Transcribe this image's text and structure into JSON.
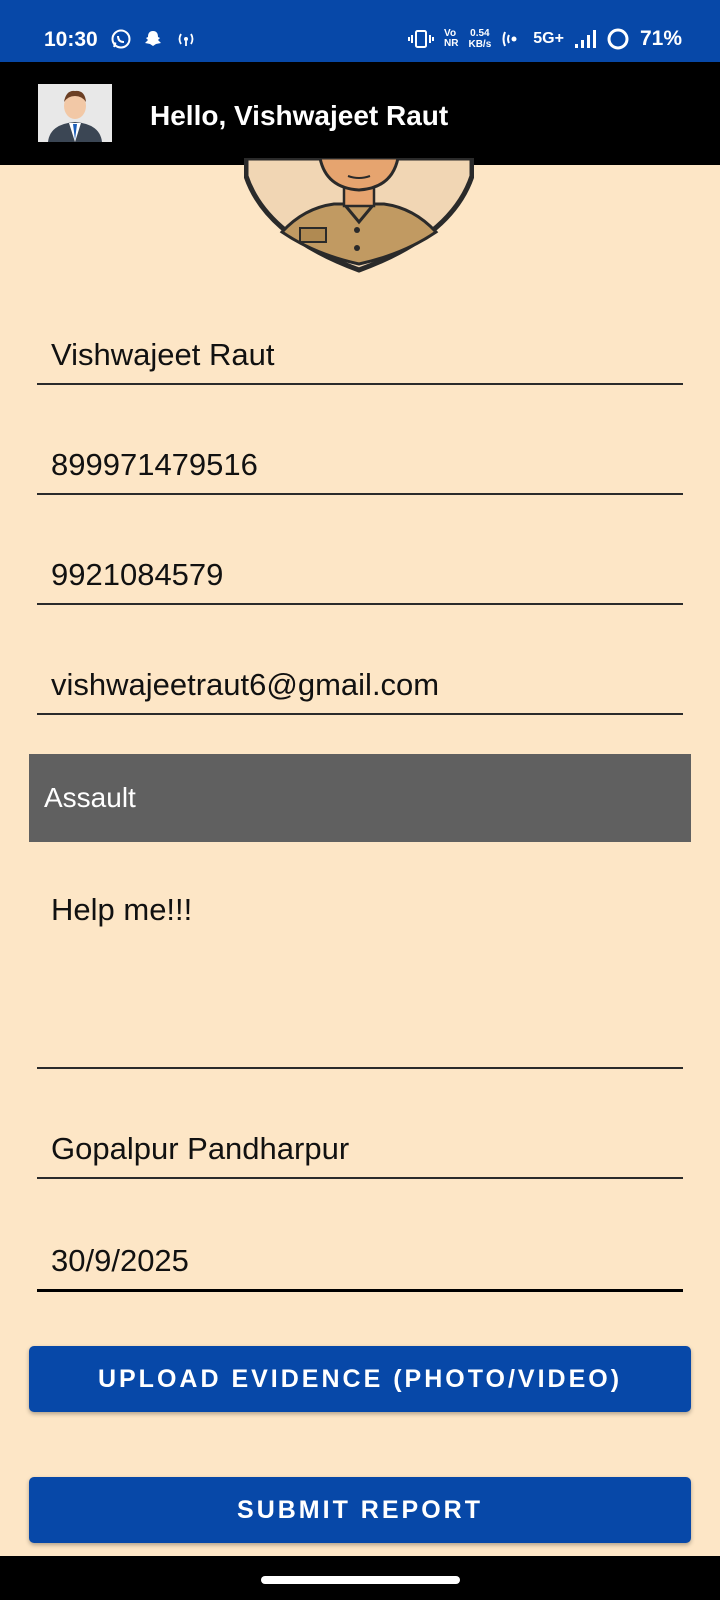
{
  "status": {
    "time": "10:30",
    "volte_top": "Vo",
    "volte_bottom": "NR",
    "speed_value": "0.54",
    "speed_unit": "KB/s",
    "network": "5G+",
    "battery": "71%"
  },
  "header": {
    "greeting": "Hello, Vishwajeet Raut"
  },
  "form": {
    "name": "Vishwajeet Raut",
    "aadhaar": "899971479516",
    "phone": "9921084579",
    "email": "vishwajeetraut6@gmail.com",
    "incident_type": "Assault",
    "description": "Help me!!!",
    "location": "Gopalpur Pandharpur",
    "date": "30/9/2025"
  },
  "buttons": {
    "upload": "UPLOAD EVIDENCE (PHOTO/VIDEO)",
    "submit": "SUBMIT REPORT"
  },
  "colors": {
    "primary": "#0748a8",
    "background": "#fde6c6",
    "spinner": "#606060"
  }
}
